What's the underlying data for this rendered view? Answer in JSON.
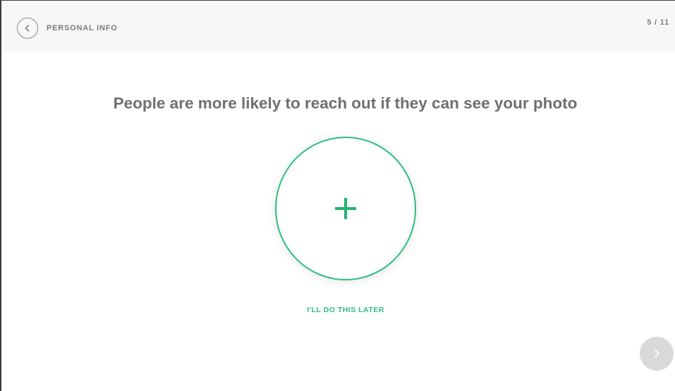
{
  "header": {
    "title": "PERSONAL INFO",
    "step_counter": "5 / 11",
    "back_icon": "chevron-left-icon"
  },
  "main": {
    "headline": "People are more likely to reach out if they can see your photo",
    "photo_upload_icon": "plus-icon",
    "skip_label": "I'LL DO THIS LATER"
  },
  "footer": {
    "next_icon": "chevron-right-icon"
  },
  "colors": {
    "accent": "#2bbf7e",
    "text_dark": "#6f6f6f",
    "text_muted": "#7c7c7c",
    "header_bg": "#f7f7f7",
    "next_button_bg": "#d9d9d9"
  }
}
